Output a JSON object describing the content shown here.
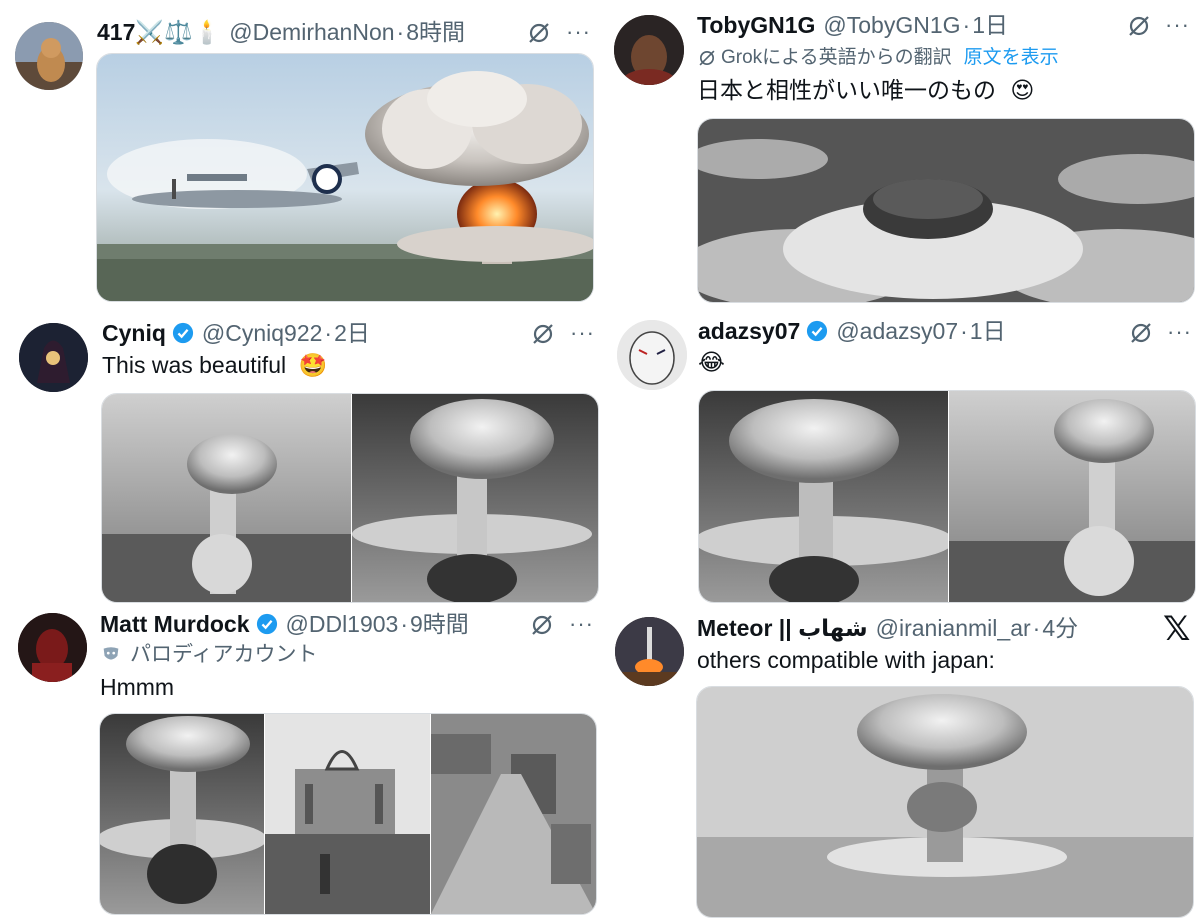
{
  "tweets": [
    {
      "name": "417⚔️⚖️🕯️",
      "handle": "@DemirhanNon",
      "time": "8時間",
      "verified": false,
      "text": "",
      "image": "B-29 bomber flying toward mushroom cloud"
    },
    {
      "name": "TobyGN1G",
      "handle": "@TobyGN1G",
      "time": "1日",
      "verified": false,
      "translation_note": "Grokによる英語からの翻訳",
      "translation_link": "原文を表示",
      "text": "日本と相性がいい唯一のもの",
      "emoji": "😍",
      "image": "aerial view of mushroom cloud over clouds"
    },
    {
      "name": "Cyniq",
      "handle": "@Cyniq922",
      "time": "2日",
      "verified": true,
      "text": "This was beautiful",
      "emoji": "🤩",
      "image": "two black-and-white mushroom cloud photos"
    },
    {
      "name": "adazsy07",
      "handle": "@adazsy07",
      "time": "1日",
      "verified": true,
      "text": "",
      "emoji": "😂",
      "image": "two black-and-white mushroom cloud photos"
    },
    {
      "name": "Matt Murdock",
      "handle": "@DDl1903",
      "time": "9時間",
      "verified": true,
      "label": "パロディアカウント",
      "text": "Hmmm",
      "image": "mushroom cloud, ruined dome, destroyed city"
    },
    {
      "name": "Meteor || شهاب",
      "handle": "@iranianmil_ar",
      "time": "4分",
      "verified": false,
      "text": "others compatible with japan:",
      "image": "black-and-white mushroom cloud"
    }
  ],
  "ui": {
    "separator": "·",
    "more_icon": "···",
    "x_logo": "𝕏",
    "grok_icon": "grok-icon",
    "accent": "#1d9bf0",
    "muted": "#536471"
  }
}
